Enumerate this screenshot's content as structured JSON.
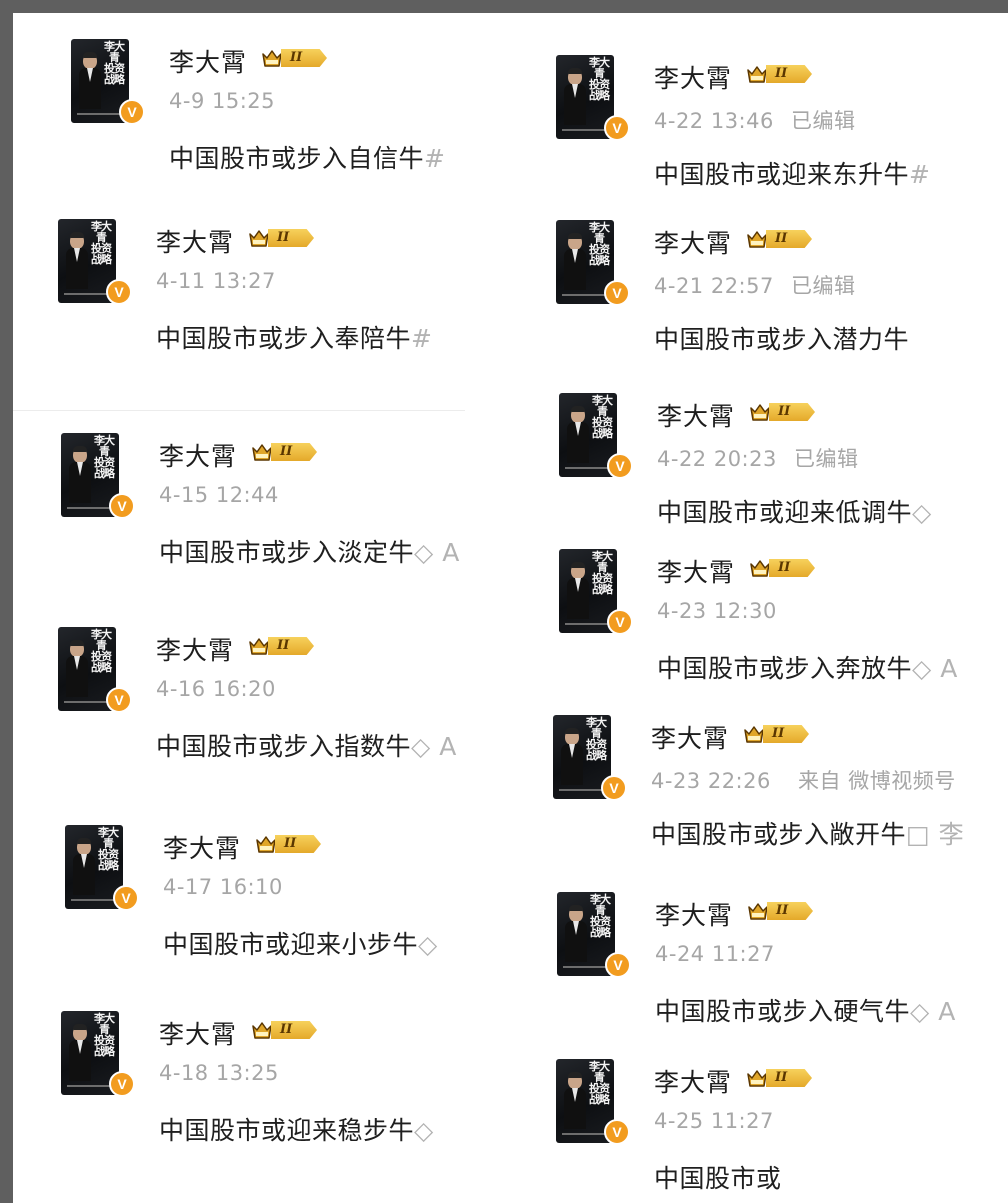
{
  "colors": {
    "background_frame": "#5f5f5f",
    "card": "#ffffff",
    "name_text": "#1d1d1d",
    "meta_text": "#a6a6a6",
    "verified_badge": "#f29c1f",
    "level_badge": "#e4a92a"
  },
  "avatar": {
    "cover_title": "李大青 投资战略",
    "badge_letter": "V"
  },
  "posts": [
    {
      "name": "李大霄",
      "level": "II",
      "time": "4-9 15:25",
      "edited": "",
      "source": "",
      "content": "中国股市或步入自信牛",
      "tail": "#"
    },
    {
      "name": "李大霄",
      "level": "II",
      "time": "4-11 13:27",
      "edited": "",
      "source": "",
      "content": "中国股市或步入奉陪牛",
      "tail": "#"
    },
    {
      "name": "李大霄",
      "level": "II",
      "time": "4-15 12:44",
      "edited": "",
      "source": "",
      "content": "中国股市或步入淡定牛",
      "tail": "◇ A"
    },
    {
      "name": "李大霄",
      "level": "II",
      "time": "4-16 16:20",
      "edited": "",
      "source": "",
      "content": "中国股市或步入指数牛",
      "tail": "◇ A"
    },
    {
      "name": "李大霄",
      "level": "II",
      "time": "4-17 16:10",
      "edited": "",
      "source": "",
      "content": "中国股市或迎来小步牛",
      "tail": "◇"
    },
    {
      "name": "李大霄",
      "level": "II",
      "time": "4-18 13:25",
      "edited": "",
      "source": "",
      "content": "中国股市或迎来稳步牛",
      "tail": "◇"
    },
    {
      "name": "李大霄",
      "level": "II",
      "time": "4-22 13:46",
      "edited": "已编辑",
      "source": "",
      "content": "中国股市或迎来东升牛",
      "tail": "#"
    },
    {
      "name": "李大霄",
      "level": "II",
      "time": "4-21 22:57",
      "edited": "已编辑",
      "source": "",
      "content": "中国股市或步入潜力牛",
      "tail": ""
    },
    {
      "name": "李大霄",
      "level": "II",
      "time": "4-22 20:23",
      "edited": "已编辑",
      "source": "",
      "content": "中国股市或迎来低调牛",
      "tail": "◇"
    },
    {
      "name": "李大霄",
      "level": "II",
      "time": "4-23 12:30",
      "edited": "",
      "source": "",
      "content": "中国股市或步入奔放牛",
      "tail": "◇ A"
    },
    {
      "name": "李大霄",
      "level": "II",
      "time": "4-23 22:26",
      "edited": "",
      "source": "来自 微博视频号",
      "content": "中国股市或步入敞开牛",
      "tail": "□ 李"
    },
    {
      "name": "李大霄",
      "level": "II",
      "time": "4-24 11:27",
      "edited": "",
      "source": "",
      "content": "中国股市或步入硬气牛",
      "tail": "◇ A"
    },
    {
      "name": "李大霄",
      "level": "II",
      "time": "4-25 11:27",
      "edited": "",
      "source": "",
      "content": "中国股市或",
      "tail": ""
    }
  ]
}
